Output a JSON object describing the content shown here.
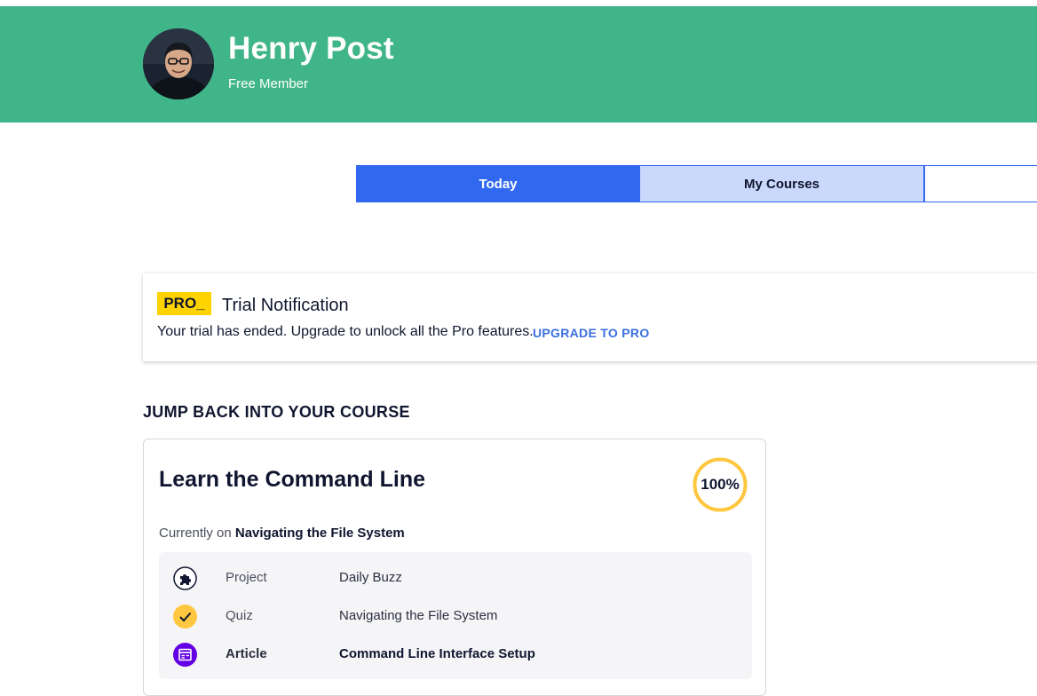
{
  "profile": {
    "name": "Henry Post",
    "membership": "Free Member"
  },
  "tabs": [
    {
      "label": "Today",
      "active": true
    },
    {
      "label": "My Courses",
      "active": false
    }
  ],
  "trial_notice": {
    "badge": "PRO_",
    "title": "Trial Notification",
    "message": "Your trial has ended. Upgrade to unlock all the Pro features.",
    "link": "UPGRADE TO PRO"
  },
  "resume_section": {
    "heading": "JUMP BACK INTO YOUR COURSE",
    "course": {
      "title": "Learn the Command Line",
      "progress_label": "100%",
      "progress": 1.0,
      "current_prefix": "Currently on",
      "current_module": "Navigating the File System",
      "items": [
        {
          "icon": "puzzle-icon",
          "type": "Project",
          "name": "Daily Buzz"
        },
        {
          "icon": "checkmark-icon",
          "type": "Quiz",
          "name": "Navigating the File System"
        },
        {
          "icon": "article-icon",
          "type": "Article",
          "name": "Command Line Interface Setup"
        }
      ]
    }
  },
  "colors": {
    "header_bg": "#41b58a",
    "tab_active": "#3069ef",
    "tab_inactive": "#c9d8fb",
    "pro_yellow": "#ffd300",
    "progress_ring": "#ffc740",
    "article_purple": "#6400e4",
    "link_blue": "#3a6fe0"
  }
}
